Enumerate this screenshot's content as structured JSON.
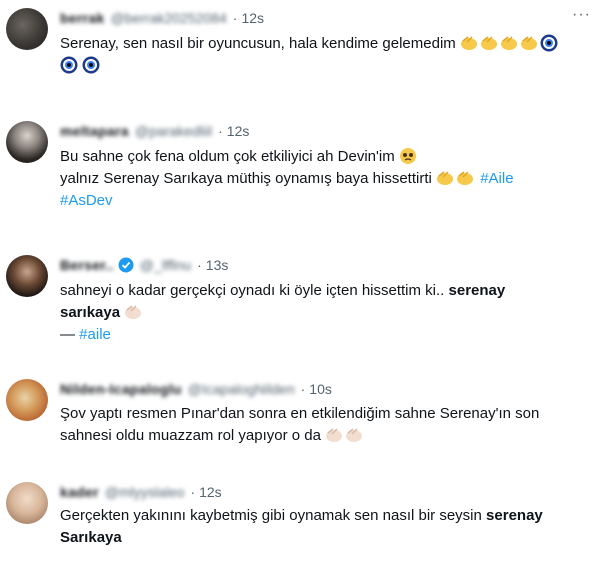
{
  "tweets": [
    {
      "name": "berrak",
      "handle": "@berrak20252084",
      "time": "12s",
      "line1": "Serenay, sen nasıl bir oyuncusun, hala kendime gelemedim"
    },
    {
      "name": "meltapara",
      "handle": "@parakedliil",
      "time": "12s",
      "line1": "Bu sahne çok fena oldum çok etkiliyici ah Devin'im",
      "line2": "yalnız Serenay Sarıkaya müthiş oynamış baya hissettirti",
      "hashtag1": "#Aile",
      "hashtag2": "#AsDev"
    },
    {
      "name": "Berser..",
      "handle": "@_lfflnu",
      "time": "13s",
      "line1_text": "sahneyi o kadar gerçekçi oynadı ki öyle içten hissettim ki..",
      "line1_bold": "serenay",
      "line2_bold": "sarıkaya",
      "dash": "—",
      "hashtag": "#aile"
    },
    {
      "name": "Nilden-Icapaloglu",
      "handle": "@IcapalogNilden",
      "time": "10s",
      "line1": "Şov yaptı resmen Pınar'dan sonra en etkilendiğim sahne Serenay'ın son",
      "line2": "sahnesi oldu muazzam rol yapıyor o da"
    },
    {
      "name": "kader",
      "handle": "@mlyyslaleo",
      "time": "12s",
      "line1_text": "Gerçekten yakınını kaybetmiş gibi oynamak sen nasıl bir seysin",
      "line1_bold": "serenay",
      "line2_bold": "Sarıkaya"
    }
  ],
  "more_label": "···",
  "colors": {
    "text": "#0f1419",
    "secondary": "#536471",
    "link": "#1d9bf0"
  }
}
